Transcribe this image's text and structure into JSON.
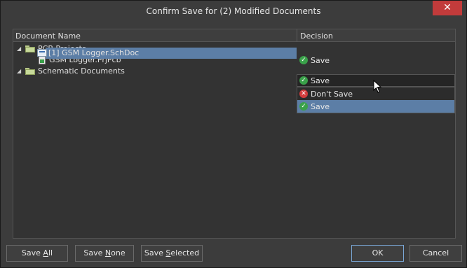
{
  "dialog": {
    "title": "Confirm Save for (2) Modified Documents",
    "close_glyph": "✕"
  },
  "grid": {
    "columns": {
      "name": "Document Name",
      "decision": "Decision"
    },
    "groups": [
      {
        "label": "PCB Projects",
        "icon": "folder-icon"
      },
      {
        "label": "Schematic Documents",
        "icon": "folder-icon"
      }
    ],
    "items": [
      {
        "label": "GSM Logger.PrjPcb",
        "icon": "pcb-project-icon",
        "decision": "Save"
      },
      {
        "label": "[1] GSM Logger.SchDoc",
        "icon": "schematic-doc-icon",
        "decision": "Save",
        "selected": true
      }
    ]
  },
  "decision_dropdown": {
    "current": "Save",
    "options": [
      {
        "label": "Don't Save",
        "icon": "dont-save-icon"
      },
      {
        "label": "Save",
        "icon": "save-check-icon",
        "highlighted": true
      }
    ]
  },
  "buttons": {
    "save_all": {
      "pre": "Save ",
      "accel": "A",
      "post": "ll"
    },
    "save_none": {
      "pre": "Save ",
      "accel": "N",
      "post": "one"
    },
    "save_selected": {
      "pre": "Save ",
      "accel": "S",
      "post": "elected"
    },
    "ok": "OK",
    "cancel": "Cancel"
  },
  "colors": {
    "selection": "#5c7ea6",
    "check": "#3aa14a",
    "cross": "#d33c3c",
    "close": "#c23b3b"
  }
}
